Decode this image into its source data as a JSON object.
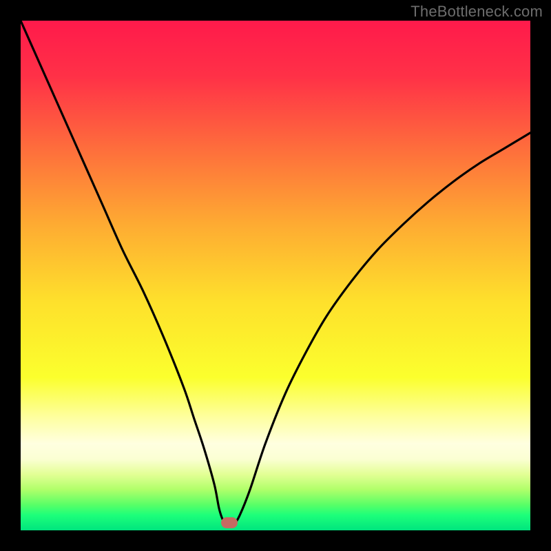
{
  "watermark": "TheBottleneck.com",
  "chart_data": {
    "type": "line",
    "title": "",
    "xlabel": "",
    "ylabel": "",
    "xlim": [
      0,
      100
    ],
    "ylim": [
      0,
      100
    ],
    "grid": false,
    "legend": false,
    "background_gradient_stops": [
      {
        "pct": 0,
        "color": "#ff1a4b"
      },
      {
        "pct": 11,
        "color": "#ff3147"
      },
      {
        "pct": 25,
        "color": "#fe6d3c"
      },
      {
        "pct": 40,
        "color": "#feab32"
      },
      {
        "pct": 55,
        "color": "#fee02c"
      },
      {
        "pct": 70,
        "color": "#fbff2d"
      },
      {
        "pct": 78,
        "color": "#feffa2"
      },
      {
        "pct": 83,
        "color": "#ffffe0"
      },
      {
        "pct": 86,
        "color": "#fbffd3"
      },
      {
        "pct": 89,
        "color": "#e3ff95"
      },
      {
        "pct": 92,
        "color": "#b0ff6a"
      },
      {
        "pct": 95,
        "color": "#58ff67"
      },
      {
        "pct": 97,
        "color": "#1dff7a"
      },
      {
        "pct": 100,
        "color": "#00e57e"
      }
    ],
    "series": [
      {
        "name": "bottleneck-curve",
        "x": [
          0,
          4,
          8,
          12,
          16,
          20,
          24,
          28,
          32,
          34,
          36,
          38,
          39,
          40,
          41,
          42,
          43,
          45,
          48,
          52,
          56,
          60,
          65,
          70,
          75,
          80,
          85,
          90,
          95,
          100
        ],
        "y": [
          100,
          91,
          82,
          73,
          64,
          55,
          47,
          38,
          28,
          22,
          16,
          9,
          4,
          1.5,
          1.5,
          1.5,
          3,
          8,
          17,
          27,
          35,
          42,
          49,
          55,
          60,
          64.5,
          68.5,
          72,
          75,
          78
        ]
      }
    ],
    "annotations": [
      {
        "name": "min-marker",
        "x": 41,
        "y": 1.5,
        "color": "#c46a62"
      }
    ]
  }
}
